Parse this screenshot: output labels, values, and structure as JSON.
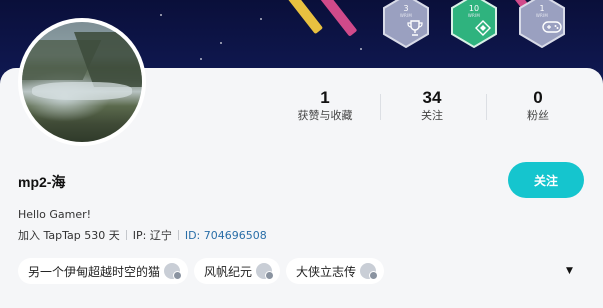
{
  "badges": [
    {
      "num": "3",
      "sub": "WRIM",
      "icon": "trophy-icon",
      "color": "#9aa0c0"
    },
    {
      "num": "10",
      "sub": "WRIM",
      "icon": "diamond-icon",
      "color": "#2fb37e"
    },
    {
      "num": "1",
      "sub": "WRIM",
      "icon": "gamepad-icon",
      "color": "#9aa0c0"
    }
  ],
  "stats": [
    {
      "value": "1",
      "label": "获赞与收藏"
    },
    {
      "value": "34",
      "label": "关注"
    },
    {
      "value": "0",
      "label": "粉丝"
    }
  ],
  "profile": {
    "name": "mp2-海",
    "bio": "Hello Gamer!",
    "joined": "加入 TapTap 530 天",
    "ip": "IP: 辽宁",
    "id": "ID: 704696508",
    "follow_label": "关注"
  },
  "games": [
    {
      "title": "另一个伊甸超越时空的猫"
    },
    {
      "title": "风帆纪元"
    },
    {
      "title": "大侠立志传"
    }
  ],
  "colors": {
    "accent": "#15c5ce",
    "banner": "#0b1140",
    "link": "#2a6fa8"
  }
}
